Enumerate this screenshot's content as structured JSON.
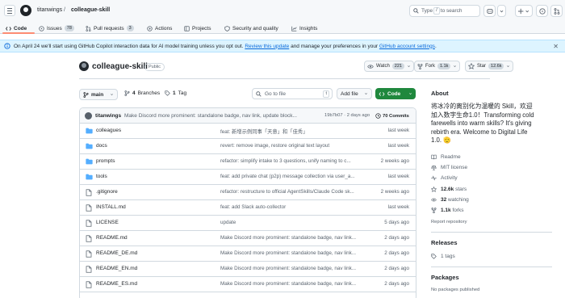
{
  "header": {
    "owner": "titanwings",
    "separator": "/",
    "repo": "colleague-skill",
    "search_prefix": "Type",
    "search_key": "/",
    "search_suffix": "to search"
  },
  "tabs": [
    {
      "label": "Code",
      "icon": "code-icon"
    },
    {
      "label": "Issues",
      "icon": "issue-icon",
      "count": "78"
    },
    {
      "label": "Pull requests",
      "icon": "pull-request-icon",
      "count": "3"
    },
    {
      "label": "Actions",
      "icon": "actions-icon"
    },
    {
      "label": "Projects",
      "icon": "projects-icon"
    },
    {
      "label": "Security and quality",
      "icon": "shield-icon"
    },
    {
      "label": "Insights",
      "icon": "graph-icon"
    }
  ],
  "banner": {
    "text": "On April 24 we'll start using GitHub Copilot interaction data for AI model training unless you opt out.",
    "link": "Review this update",
    "text2": "and manage your preferences in your",
    "link2": "GitHub account settings",
    "end": "."
  },
  "repo": {
    "name": "colleague-skill",
    "visibility": "Public",
    "watch_label": "Watch",
    "watch_count": "221",
    "fork_label": "Fork",
    "fork_count": "1.1k",
    "star_label": "Star",
    "star_count": "12.6k"
  },
  "toolbar": {
    "branch": "main",
    "branches_count": "4",
    "branches_label": "Branches",
    "tags_count": "1",
    "tags_label": "Tag",
    "goto_placeholder": "Go to file",
    "goto_key": "t",
    "add_file": "Add file",
    "code": "Code"
  },
  "commit": {
    "user": "titanwings",
    "message": "Make Discord more prominent: standalone badge, nav link, update block...",
    "hash": "19b7b07 · 2 days ago",
    "commits": "70 Commits"
  },
  "files": [
    {
      "type": "folder",
      "name": "colleagues",
      "message": "feat: 新增示例同事「天意」和「佳秀」",
      "date": "last week"
    },
    {
      "type": "folder",
      "name": "docs",
      "message": "revert: remove image, restore original text layout",
      "date": "last week"
    },
    {
      "type": "folder",
      "name": "prompts",
      "message": "refactor: simplify intake to 3 questions, unify naming to c...",
      "date": "2 weeks ago"
    },
    {
      "type": "folder",
      "name": "tools",
      "message": "feat: add private chat (p2p) message collection via user_a...",
      "date": "last week"
    },
    {
      "type": "file",
      "name": ".gitignore",
      "message": "refactor: restructure to official AgentSkills/Claude Code sk...",
      "date": "2 weeks ago"
    },
    {
      "type": "file",
      "name": "INSTALL.md",
      "message": "feat: add Slack auto-collector",
      "date": "last week"
    },
    {
      "type": "file",
      "name": "LICENSE",
      "message": "update",
      "date": "5 days ago"
    },
    {
      "type": "file",
      "name": "README.md",
      "message": "Make Discord more prominent: standalone badge, nav link...",
      "date": "2 days ago"
    },
    {
      "type": "file",
      "name": "README_DE.md",
      "message": "Make Discord more prominent: standalone badge, nav link...",
      "date": "2 days ago"
    },
    {
      "type": "file",
      "name": "README_EN.md",
      "message": "Make Discord more prominent: standalone badge, nav link...",
      "date": "2 days ago"
    },
    {
      "type": "file",
      "name": "README_ES.md",
      "message": "Make Discord more prominent: standalone badge, nav link...",
      "date": "2 days ago"
    }
  ],
  "sidebar": {
    "about_title": "About",
    "about_text": "将冰冷的离别化为温暖的 Skill，欢迎加入数字生命1.0！Transforming cold farewells into warm skills? It's giving rebirth era. Welcome to Digital Life 1.0. 🫡",
    "items": [
      {
        "icon": "book-icon",
        "label": "Readme"
      },
      {
        "icon": "law-icon",
        "label": "MIT license"
      },
      {
        "icon": "pulse-icon",
        "label": "Activity"
      }
    ],
    "stats": [
      {
        "icon": "star-icon",
        "value": "12.6k",
        "label": "stars"
      },
      {
        "icon": "eye-icon",
        "value": "32",
        "label": "watching"
      },
      {
        "icon": "fork-icon",
        "value": "1.1k",
        "label": "forks"
      }
    ],
    "report": "Report repository",
    "releases_title": "Releases",
    "releases_tags": "1 tags",
    "packages_title": "Packages",
    "packages_text": "No packages published"
  }
}
